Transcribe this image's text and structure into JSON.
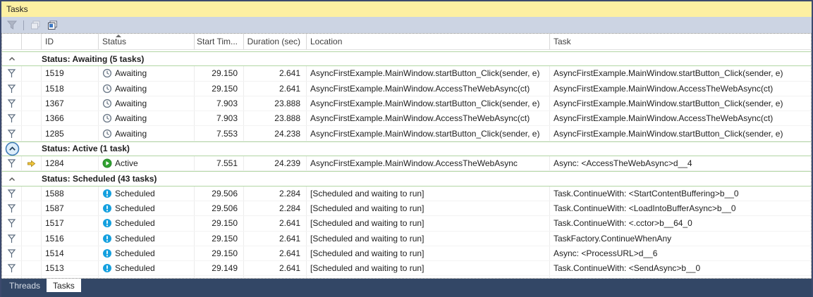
{
  "window": {
    "title": "Tasks"
  },
  "toolbar": {
    "buttons": [
      {
        "name": "filter-tasks-button",
        "icon": "filter-icon",
        "enabled": false
      },
      {
        "name": "collapse-groups-button",
        "icon": "stacked-panels-disabled-icon",
        "enabled": false
      },
      {
        "name": "expand-groups-button",
        "icon": "stacked-panels-icon",
        "enabled": true
      }
    ]
  },
  "colors": {
    "titlebar_bg": "#fdf0a2",
    "toolbar_bg": "#ccd4e3",
    "window_border": "#3c4a6e",
    "tabstrip_bg": "#334766",
    "group_separator_green": "#b2d6a4",
    "awaiting_clock_gray": "#6e7b8a",
    "active_green": "#30a230",
    "scheduled_blue": "#14a0df",
    "flag_outline": "#5a6b7d",
    "current_arrow_yellow": "#f3c73a"
  },
  "table": {
    "columns": [
      {
        "key": "flag",
        "label": ""
      },
      {
        "key": "current",
        "label": ""
      },
      {
        "key": "id",
        "label": "ID"
      },
      {
        "key": "status",
        "label": "Status",
        "sort": "asc"
      },
      {
        "key": "start",
        "label": "Start Tim..."
      },
      {
        "key": "duration",
        "label": "Duration (sec)"
      },
      {
        "key": "location",
        "label": "Location"
      },
      {
        "key": "task",
        "label": "Task"
      }
    ],
    "groups": [
      {
        "label": "Status: Awaiting (5 tasks)",
        "chevron": "chevron-up-icon",
        "rows": [
          {
            "id": "1519",
            "status": "Awaiting",
            "status_icon": "clock-icon",
            "start": "29.150",
            "duration": "2.641",
            "location": "AsyncFirstExample.MainWindow.startButton_Click(sender, e)",
            "task": "AsyncFirstExample.MainWindow.startButton_Click(sender, e)"
          },
          {
            "id": "1518",
            "status": "Awaiting",
            "status_icon": "clock-icon",
            "start": "29.150",
            "duration": "2.641",
            "location": "AsyncFirstExample.MainWindow.AccessTheWebAsync(ct)",
            "task": "AsyncFirstExample.MainWindow.AccessTheWebAsync(ct)"
          },
          {
            "id": "1367",
            "status": "Awaiting",
            "status_icon": "clock-icon",
            "start": "7.903",
            "duration": "23.888",
            "location": "AsyncFirstExample.MainWindow.startButton_Click(sender, e)",
            "task": "AsyncFirstExample.MainWindow.startButton_Click(sender, e)"
          },
          {
            "id": "1366",
            "status": "Awaiting",
            "status_icon": "clock-icon",
            "start": "7.903",
            "duration": "23.888",
            "location": "AsyncFirstExample.MainWindow.AccessTheWebAsync(ct)",
            "task": "AsyncFirstExample.MainWindow.AccessTheWebAsync(ct)"
          },
          {
            "id": "1285",
            "status": "Awaiting",
            "status_icon": "clock-icon",
            "start": "7.553",
            "duration": "24.238",
            "location": "AsyncFirstExample.MainWindow.startButton_Click(sender, e)",
            "task": "AsyncFirstExample.MainWindow.startButton_Click(sender, e)"
          }
        ]
      },
      {
        "label": "Status: Active (1 task)",
        "chevron": "circled-chevron-up-icon",
        "rows": [
          {
            "id": "1284",
            "current": true,
            "status": "Active",
            "status_icon": "play-circle-icon",
            "start": "7.551",
            "duration": "24.239",
            "location": "AsyncFirstExample.MainWindow.AccessTheWebAsync",
            "task": "Async: <AccessTheWebAsync>d__4"
          }
        ]
      },
      {
        "label": "Status: Scheduled (43 tasks)",
        "chevron": "chevron-up-icon",
        "rows": [
          {
            "id": "1588",
            "status": "Scheduled",
            "status_icon": "exclamation-circle-icon",
            "start": "29.506",
            "duration": "2.284",
            "location": "[Scheduled and waiting to run]",
            "task": "Task.ContinueWith: <StartContentBuffering>b__0"
          },
          {
            "id": "1587",
            "status": "Scheduled",
            "status_icon": "exclamation-circle-icon",
            "start": "29.506",
            "duration": "2.284",
            "location": "[Scheduled and waiting to run]",
            "task": "Task.ContinueWith: <LoadIntoBufferAsync>b__0"
          },
          {
            "id": "1517",
            "status": "Scheduled",
            "status_icon": "exclamation-circle-icon",
            "start": "29.150",
            "duration": "2.641",
            "location": "[Scheduled and waiting to run]",
            "task": "Task.ContinueWith: <.cctor>b__64_0"
          },
          {
            "id": "1516",
            "status": "Scheduled",
            "status_icon": "exclamation-circle-icon",
            "start": "29.150",
            "duration": "2.641",
            "location": "[Scheduled and waiting to run]",
            "task": "TaskFactory.ContinueWhenAny"
          },
          {
            "id": "1514",
            "status": "Scheduled",
            "status_icon": "exclamation-circle-icon",
            "start": "29.150",
            "duration": "2.641",
            "location": "[Scheduled and waiting to run]",
            "task": "Async: <ProcessURL>d__6"
          },
          {
            "id": "1513",
            "status": "Scheduled",
            "status_icon": "exclamation-circle-icon",
            "start": "29.149",
            "duration": "2.641",
            "location": "[Scheduled and waiting to run]",
            "task": "Task.ContinueWith: <SendAsync>b__0"
          }
        ]
      }
    ],
    "partial_row": {
      "status_icon": "exclamation-circle-icon"
    }
  },
  "tabs": [
    {
      "label": "Threads",
      "active": false
    },
    {
      "label": "Tasks",
      "active": true
    }
  ]
}
